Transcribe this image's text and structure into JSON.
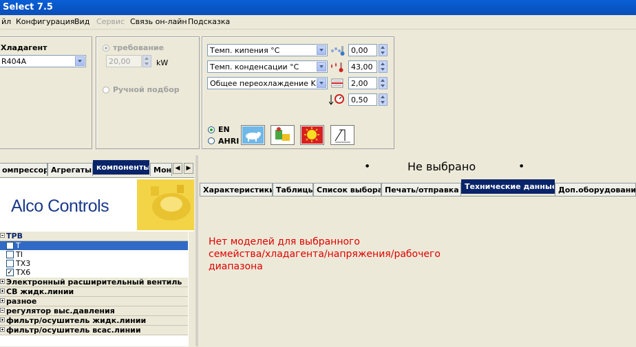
{
  "window": {
    "title": "Select 7.5"
  },
  "menu": [
    "йл",
    "Конфигурация",
    "Вид",
    "Сервис",
    "Связь он-лайн",
    "Подсказка"
  ],
  "refrigerant": {
    "label": "Хладагент",
    "value": "R404A"
  },
  "capacity": {
    "requirement_label": "требование",
    "value": "20,00",
    "unit": "kW",
    "manual_label": "Ручной подбор"
  },
  "conditions": {
    "evap_label": "Темп. кипения °C",
    "evap_value": "0,00",
    "cond_label": "Темп. конденсации °C",
    "cond_value": "43,00",
    "subcool_label": "Общее переохлаждение K",
    "subcool_value": "2,00",
    "pressure_value": "0,50"
  },
  "standard": {
    "en": "EN",
    "ahri": "AHRI"
  },
  "left_tabs": [
    "омпрессоры",
    "Агрегаты",
    "компоненты",
    "Мон"
  ],
  "brand": {
    "name": "Alco Controls"
  },
  "tree": {
    "groups": [
      {
        "label": "TPB"
      },
      {
        "label": "Электронный расширительный вентиль"
      },
      {
        "label": "СВ жидк.линии"
      },
      {
        "label": "разное"
      },
      {
        "label": "регулятор выс.давления"
      },
      {
        "label": "фильтр/осушитель жидк.линии"
      },
      {
        "label": "фильтр/осушитель всас.линии"
      }
    ],
    "items": [
      {
        "label": "T",
        "checked": ""
      },
      {
        "label": "TI",
        "checked": ""
      },
      {
        "label": "TX3",
        "checked": ""
      },
      {
        "label": "TX6",
        "checked": "✓"
      }
    ]
  },
  "status": {
    "text": "Не выбрано"
  },
  "right_tabs": [
    "Характеристики",
    "Таблицы",
    "Список выбора",
    "Печать/отправка",
    "Технические данные",
    "Доп.оборудование"
  ],
  "message": {
    "line1": "Нет моделей для выбранного",
    "line2": "семейства/хладагента/напряжения/рабочего",
    "line3": "диапазона"
  },
  "colors": {
    "tab_active": "#0a246a",
    "message": "#e00000",
    "selection": "#316ac5",
    "titlebar": "#0854c4"
  }
}
